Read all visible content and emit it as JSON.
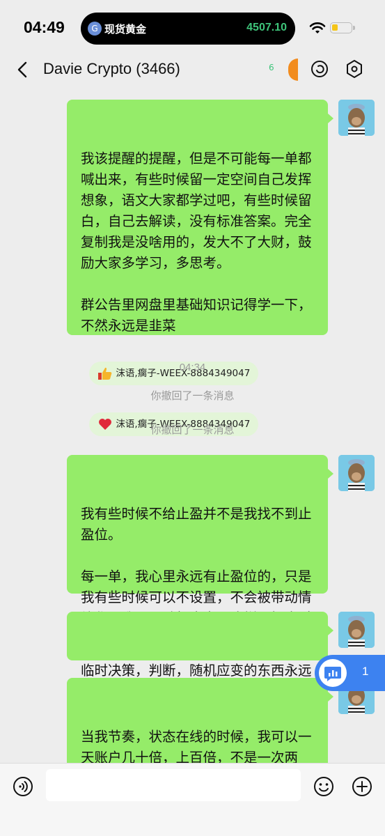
{
  "status_bar": {
    "time": "04:49",
    "island_label": "现货黄金",
    "island_price": "4507.10",
    "price_color": "#3ec47a"
  },
  "nav": {
    "title": "Davie Crypto (3466)",
    "mini_glyph": "6"
  },
  "messages": [
    {
      "text": "我该提醒的提醒，但是不可能每一单都喊出来，有些时候留一定空间自己发挥想象，语文大家都学过吧，有些时候留白，自己去解读，没有标准答案。完全复制我是没啥用的，发大不了大财，鼓励大家多学习，多思考。\n\n群公告里网盘里基础知识记得学一下，不然永远是韭菜",
      "reactions": [
        {
          "icon": "thumbs-up-icon",
          "text": "沫语,瘸子-WEEX-8884349047"
        },
        {
          "icon": "heart-icon",
          "text": "沫语,瘸子-WEEX-8884349047"
        }
      ]
    },
    {
      "text": "我有些时候不给止盈并不是我找不到止盈位。\n\n每一单，我心里永远有止盈位的，只是我有些时候可以不设置，不会被带动情绪化，我可以随机应变，这样更好应对市场波动"
    },
    {
      "text": "临时决策，判断，随机应变的东西永远无法复制。每个人都有区别的"
    },
    {
      "text": "当我节奏，状态在线的时候，我可以一天账户几十倍，上百倍，不是一次两次，这几年经历几十次，你觉得这还是运气吗?"
    }
  ],
  "timestamp": "04:34",
  "system_messages": [
    "你撤回了一条消息",
    "你撤回了一条消息"
  ],
  "floating_chip": {
    "count": "1"
  },
  "colors": {
    "bubble": "#95ec69",
    "background": "#ededed",
    "chip": "#3d82f0"
  }
}
